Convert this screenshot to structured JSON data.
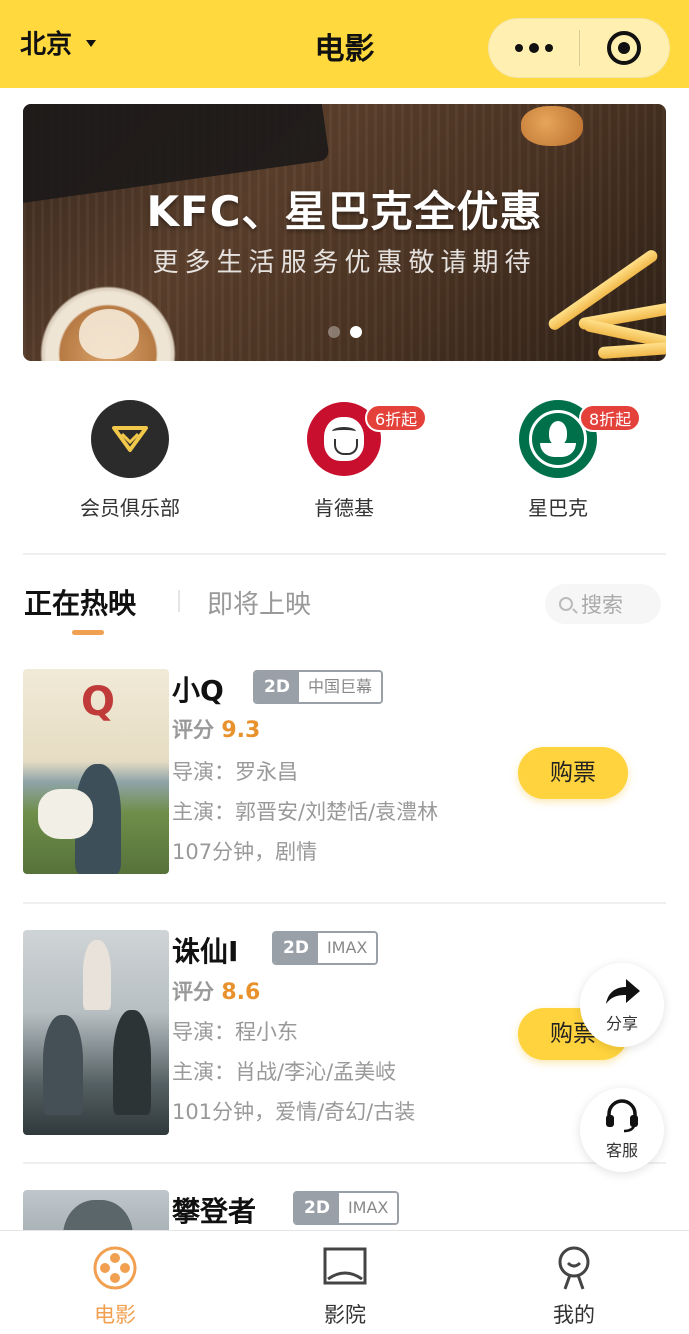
{
  "header": {
    "city": "北京",
    "title": "电影"
  },
  "banner": {
    "headline": "KFC、星巴克全优惠",
    "subline": "更多生活服务优惠敬请期待"
  },
  "brands": [
    {
      "label": "会员俱乐部",
      "badge": ""
    },
    {
      "label": "肯德基",
      "badge": "6折起"
    },
    {
      "label": "星巴克",
      "badge": "8折起"
    }
  ],
  "tabs": {
    "now_showing": "正在热映",
    "coming_soon": "即将上映",
    "search_placeholder": "搜索"
  },
  "movies": [
    {
      "title": "小Q",
      "format": "2D",
      "screen": "中国巨幕",
      "score_label": "评分",
      "score": "9.3",
      "director": "导演：罗永昌",
      "cast": "主演：郭晋安/刘楚恬/袁澧林",
      "info": "107分钟，剧情",
      "buy": "购票"
    },
    {
      "title": "诛仙I",
      "format": "2D",
      "screen": "IMAX",
      "score_label": "评分",
      "score": "8.6",
      "director": "导演：程小东",
      "cast": "主演：肖战/李沁/孟美岐",
      "info": "101分钟，爱情/奇幻/古装",
      "buy": "购票"
    },
    {
      "title": "攀登者",
      "format": "2D",
      "screen": "IMAX"
    }
  ],
  "floating": {
    "share": "分享",
    "service": "客服"
  },
  "nav": [
    {
      "label": "电影",
      "icon": "film-reel-icon"
    },
    {
      "label": "影院",
      "icon": "cinema-icon"
    },
    {
      "label": "我的",
      "icon": "user-icon"
    }
  ],
  "colors": {
    "header_bg": "#ffd93d",
    "accent_orange": "#f0a050",
    "score": "#e8922e",
    "buy_button": "#ffd33d",
    "badge_red": "#e4413a"
  }
}
